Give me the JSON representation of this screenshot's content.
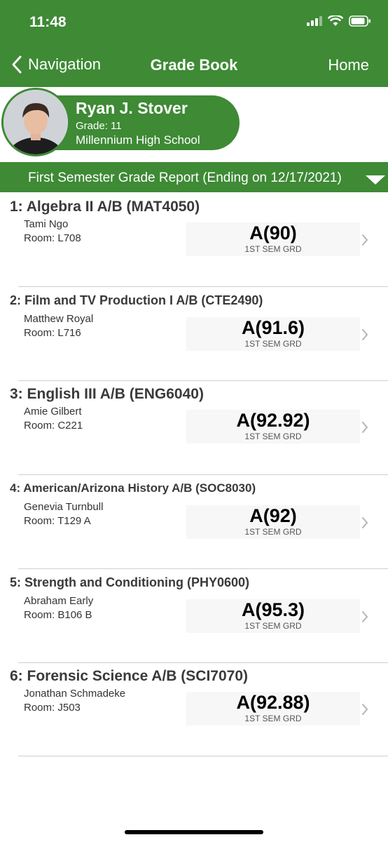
{
  "status_bar": {
    "time": "11:48"
  },
  "nav": {
    "back_label": "Navigation",
    "title": "Grade Book",
    "home_label": "Home"
  },
  "student": {
    "name": "Ryan J. Stover",
    "grade": "Grade: 11",
    "school": "Millennium High School"
  },
  "report": {
    "label": "First Semester Grade Report (Ending on 12/17/2021)"
  },
  "courses": [
    {
      "title": "1: Algebra II A/B (MAT4050)",
      "teacher": "Tami Ngo",
      "room": "Room: L708",
      "grade": "A(90)",
      "grade_caption": "1ST SEM GRD"
    },
    {
      "title": "2: Film and TV Production I A/B (CTE2490)",
      "teacher": "Matthew Royal",
      "room": "Room: L716",
      "grade": "A(91.6)",
      "grade_caption": "1ST SEM GRD"
    },
    {
      "title": "3: English III A/B (ENG6040)",
      "teacher": "Amie Gilbert",
      "room": "Room: C221",
      "grade": "A(92.92)",
      "grade_caption": "1ST SEM GRD"
    },
    {
      "title": "4: American/Arizona History A/B (SOC8030)",
      "teacher": "Genevia Turnbull",
      "room": "Room: T129 A",
      "grade": "A(92)",
      "grade_caption": "1ST SEM GRD"
    },
    {
      "title": "5: Strength and Conditioning (PHY0600)",
      "teacher": "Abraham Early",
      "room": "Room: B106 B",
      "grade": "A(95.3)",
      "grade_caption": "1ST SEM GRD"
    },
    {
      "title": "6: Forensic Science A/B (SCI7070)",
      "teacher": "Jonathan Schmadeke",
      "room": "Room: J503",
      "grade": "A(92.88)",
      "grade_caption": "1ST SEM GRD"
    }
  ],
  "colors": {
    "accent": "#3e8a35",
    "grade_box": "#f7f7f7",
    "divider": "#cfcfcf"
  }
}
